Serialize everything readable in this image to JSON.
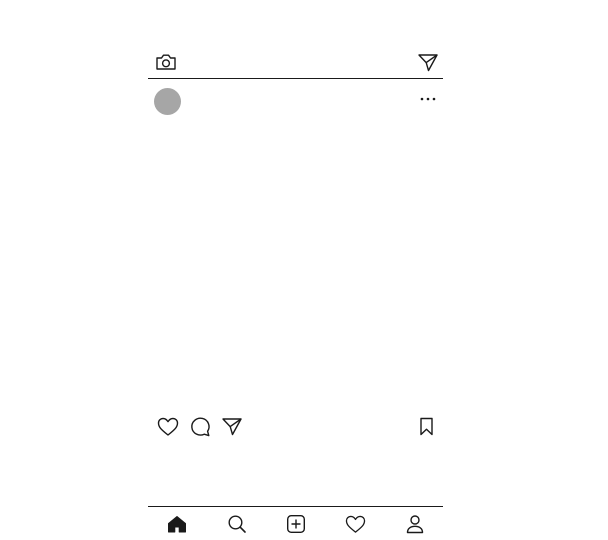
{
  "top_bar": {
    "camera_icon": "camera-icon",
    "direct_icon": "paper-plane-icon"
  },
  "post": {
    "header": {
      "avatar_color": "#a6a6a6",
      "more_icon": "ellipsis-icon"
    },
    "actions": {
      "like_icon": "heart-icon",
      "comment_icon": "speech-bubble-icon",
      "share_icon": "paper-plane-icon",
      "save_icon": "bookmark-icon"
    }
  },
  "bottom_nav": {
    "items": [
      {
        "icon": "home-icon",
        "active": true
      },
      {
        "icon": "search-icon",
        "active": false
      },
      {
        "icon": "new-post-icon",
        "active": false
      },
      {
        "icon": "activity-heart-icon",
        "active": false
      },
      {
        "icon": "profile-icon",
        "active": false
      }
    ]
  },
  "colors": {
    "stroke": "#1a1a1a",
    "background": "#ffffff",
    "avatar": "#a6a6a6"
  }
}
